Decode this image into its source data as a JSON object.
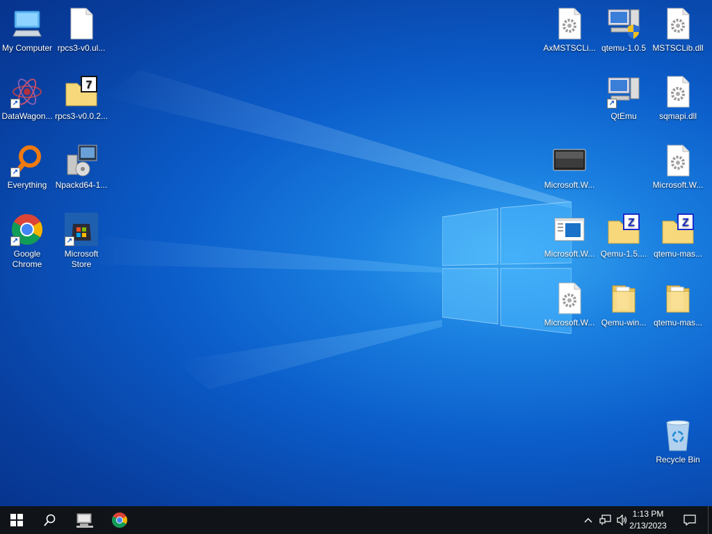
{
  "desktop": {
    "icons": [
      {
        "id": "my-computer",
        "label": "My Computer"
      },
      {
        "id": "rpcs3-ul",
        "label": "rpcs3-v0.ul..."
      },
      {
        "id": "datawagon",
        "label": "DataWagon..."
      },
      {
        "id": "rpcs3-v002",
        "label": "rpcs3-v0.0.2..."
      },
      {
        "id": "everything",
        "label": "Everything"
      },
      {
        "id": "npackd",
        "label": "Npackd64-1..."
      },
      {
        "id": "chrome",
        "label": "Google Chrome"
      },
      {
        "id": "msstore",
        "label": "Microsoft Store"
      },
      {
        "id": "axmstsclib",
        "label": "AxMSTSCLi..."
      },
      {
        "id": "qtemu105",
        "label": "qtemu-1.0.5"
      },
      {
        "id": "mstsclib",
        "label": "MSTSCLib.dll"
      },
      {
        "id": "qtemu",
        "label": "QtEmu"
      },
      {
        "id": "sqmapi",
        "label": "sqmapi.dll"
      },
      {
        "id": "msw1",
        "label": "Microsoft.W..."
      },
      {
        "id": "msw2",
        "label": "Microsoft.W..."
      },
      {
        "id": "msw3",
        "label": "Microsoft.W..."
      },
      {
        "id": "qemu15",
        "label": "Qemu-1.5...."
      },
      {
        "id": "qtemu-mas1",
        "label": "qtemu-mas..."
      },
      {
        "id": "msw4",
        "label": "Microsoft.W..."
      },
      {
        "id": "qemu-win",
        "label": "Qemu-win..."
      },
      {
        "id": "qtemu-mas2",
        "label": "qtemu-mas..."
      },
      {
        "id": "recycle",
        "label": "Recycle Bin"
      }
    ]
  },
  "taskbar": {
    "clock_time": "1:13 PM",
    "clock_date": "2/13/2023"
  },
  "colors": {
    "taskbar_bg": "#101418",
    "accent": "#0b5cc9"
  }
}
